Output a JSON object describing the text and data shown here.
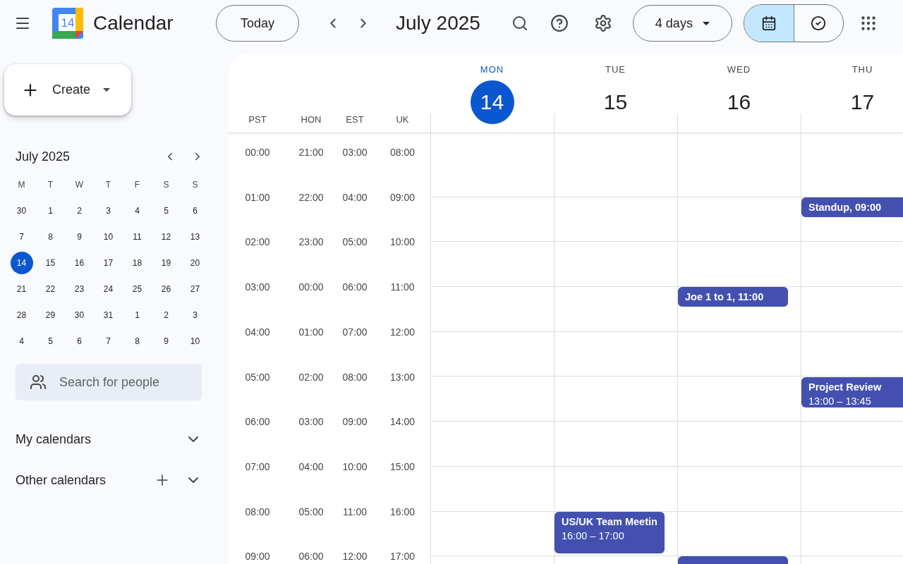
{
  "header": {
    "app_name": "Calendar",
    "logo_day": "14",
    "today_button": "Today",
    "period": "July 2025",
    "view_select": "4 days",
    "view_toggle": [
      {
        "kind": "calendar",
        "selected": true
      },
      {
        "kind": "tasks",
        "selected": false
      }
    ]
  },
  "sidebar": {
    "create_button": "Create",
    "mini_calendar": {
      "title": "July 2025",
      "weekdays": [
        "M",
        "T",
        "W",
        "T",
        "F",
        "S",
        "S"
      ],
      "weeks": [
        [
          {
            "day": "30",
            "selected": false
          },
          {
            "day": "1",
            "selected": false
          },
          {
            "day": "2",
            "selected": false
          },
          {
            "day": "3",
            "selected": false
          },
          {
            "day": "4",
            "selected": false
          },
          {
            "day": "5",
            "selected": false
          },
          {
            "day": "6",
            "selected": false
          }
        ],
        [
          {
            "day": "7",
            "selected": false
          },
          {
            "day": "8",
            "selected": false
          },
          {
            "day": "9",
            "selected": false
          },
          {
            "day": "10",
            "selected": false
          },
          {
            "day": "11",
            "selected": false
          },
          {
            "day": "12",
            "selected": false
          },
          {
            "day": "13",
            "selected": false
          }
        ],
        [
          {
            "day": "14",
            "selected": true
          },
          {
            "day": "15",
            "selected": false
          },
          {
            "day": "16",
            "selected": false
          },
          {
            "day": "17",
            "selected": false
          },
          {
            "day": "18",
            "selected": false
          },
          {
            "day": "19",
            "selected": false
          },
          {
            "day": "20",
            "selected": false
          }
        ],
        [
          {
            "day": "21",
            "selected": false
          },
          {
            "day": "22",
            "selected": false
          },
          {
            "day": "23",
            "selected": false
          },
          {
            "day": "24",
            "selected": false
          },
          {
            "day": "25",
            "selected": false
          },
          {
            "day": "26",
            "selected": false
          },
          {
            "day": "27",
            "selected": false
          }
        ],
        [
          {
            "day": "28",
            "selected": false
          },
          {
            "day": "29",
            "selected": false
          },
          {
            "day": "30",
            "selected": false
          },
          {
            "day": "31",
            "selected": false
          },
          {
            "day": "1",
            "selected": false
          },
          {
            "day": "2",
            "selected": false
          },
          {
            "day": "3",
            "selected": false
          }
        ],
        [
          {
            "day": "4",
            "selected": false
          },
          {
            "day": "5",
            "selected": false
          },
          {
            "day": "6",
            "selected": false
          },
          {
            "day": "7",
            "selected": false
          },
          {
            "day": "8",
            "selected": false
          },
          {
            "day": "9",
            "selected": false
          },
          {
            "day": "10",
            "selected": false
          }
        ]
      ]
    },
    "people_search": {
      "placeholder": "Search for people"
    },
    "sections": [
      {
        "label": "My calendars",
        "kind": "plain",
        "expanded": false
      },
      {
        "label": "Other calendars",
        "kind": "addable",
        "expanded": false
      }
    ]
  },
  "time_zones": [
    {
      "label": "PST"
    },
    {
      "label": "HON"
    },
    {
      "label": "EST"
    },
    {
      "label": "UK"
    }
  ],
  "days": [
    {
      "weekday": "MON",
      "date": "14",
      "today": true
    },
    {
      "weekday": "TUE",
      "date": "15",
      "today": false
    },
    {
      "weekday": "WED",
      "date": "16",
      "today": false
    },
    {
      "weekday": "THU",
      "date": "17",
      "today": false
    }
  ],
  "rows": [
    {
      "times": [
        "00:00",
        "21:00",
        "03:00",
        "08:00"
      ],
      "cells": [
        {},
        {},
        {},
        {}
      ]
    },
    {
      "times": [
        "01:00",
        "22:00",
        "04:00",
        "09:00"
      ],
      "cells": [
        {},
        {},
        {},
        {
          "events": [
            {
              "kind": "half",
              "title": "Standup, 09:00"
            }
          ]
        }
      ]
    },
    {
      "times": [
        "02:00",
        "23:00",
        "05:00",
        "10:00"
      ],
      "cells": [
        {},
        {},
        {},
        {}
      ]
    },
    {
      "times": [
        "03:00",
        "00:00",
        "06:00",
        "11:00"
      ],
      "cells": [
        {},
        {},
        {
          "events": [
            {
              "kind": "half",
              "title": "Joe 1 to 1, 11:00"
            }
          ]
        },
        {}
      ]
    },
    {
      "times": [
        "04:00",
        "01:00",
        "07:00",
        "12:00"
      ],
      "cells": [
        {},
        {},
        {},
        {}
      ]
    },
    {
      "times": [
        "05:00",
        "02:00",
        "08:00",
        "13:00"
      ],
      "cells": [
        {},
        {},
        {},
        {
          "events": [
            {
              "kind": "three_quarter",
              "title": "Project Review",
              "time": "13:00 – 13:45"
            }
          ]
        }
      ]
    },
    {
      "times": [
        "06:00",
        "03:00",
        "09:00",
        "14:00"
      ],
      "cells": [
        {},
        {},
        {},
        {}
      ]
    },
    {
      "times": [
        "07:00",
        "04:00",
        "10:00",
        "15:00"
      ],
      "cells": [
        {},
        {},
        {},
        {}
      ]
    },
    {
      "times": [
        "08:00",
        "05:00",
        "11:00",
        "16:00"
      ],
      "cells": [
        {},
        {
          "events": [
            {
              "kind": "hour",
              "title": "US/UK Team Meetin",
              "time": "16:00 – 17:00"
            }
          ]
        },
        {},
        {}
      ]
    },
    {
      "times": [
        "09:00",
        "06:00",
        "12:00",
        "17:00"
      ],
      "cells": [
        {},
        {},
        {
          "events": [
            {
              "kind": "half"
            }
          ]
        },
        {}
      ]
    }
  ]
}
